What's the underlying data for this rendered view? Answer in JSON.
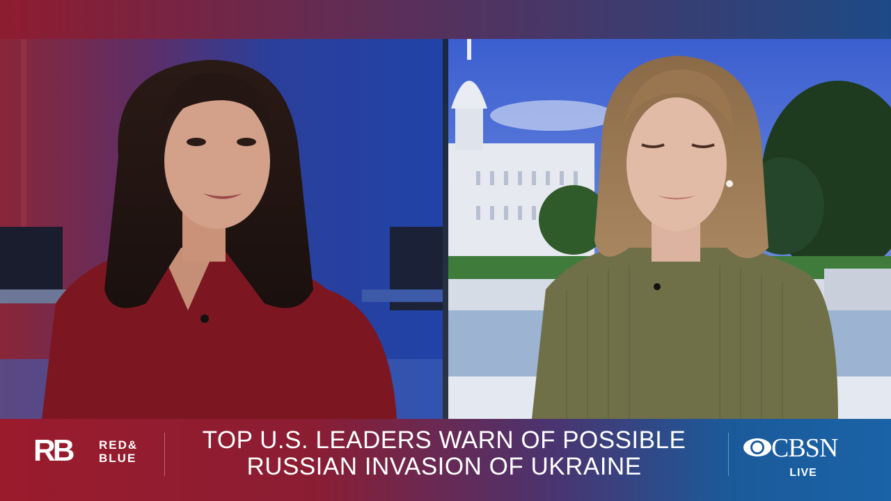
{
  "broadcast": {
    "headline_line1": "TOP U.S. LEADERS WARN OF POSSIBLE",
    "headline_line2": "RUSSIAN INVASION OF UKRAINE",
    "brand_logo": "RB",
    "brand_line1": "RED&",
    "brand_line2": "BLUE",
    "network": "CBSN",
    "live_label": "LIVE"
  },
  "colors": {
    "accent_red": "#9a1b2c",
    "accent_blue": "#1a63a6",
    "text": "#ffffff"
  },
  "icons": {
    "network_logo": "cbs-eye-icon"
  }
}
